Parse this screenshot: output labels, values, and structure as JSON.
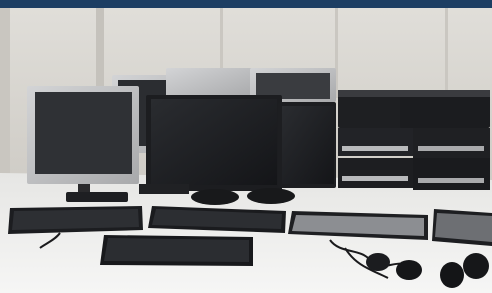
{
  "image": {
    "kind": "photo",
    "description_colors": {
      "wall": "#d7d5d0",
      "table": "#efefed",
      "header_bar": "#1d3e63",
      "equipment_dark": "#1a1a1c",
      "monitor_silver": "#bfc0c2"
    }
  }
}
